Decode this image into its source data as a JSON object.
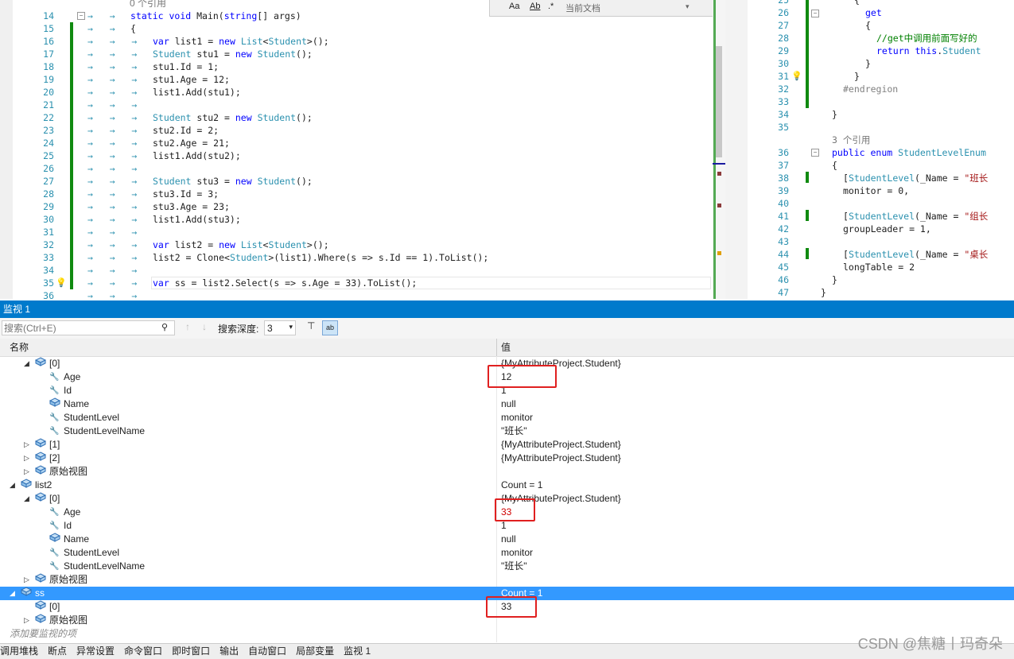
{
  "editor_left": {
    "ref_hint": "0 个引用",
    "lines": [
      {
        "n": "14",
        "code": "static void Main(string[] args)"
      },
      {
        "n": "15",
        "code": "{"
      },
      {
        "n": "16",
        "code": "var list1 = new List<Student>();"
      },
      {
        "n": "17",
        "code": "Student stu1 = new Student();"
      },
      {
        "n": "18",
        "code": "stu1.Id = 1;"
      },
      {
        "n": "19",
        "code": "stu1.Age = 12;"
      },
      {
        "n": "20",
        "code": "list1.Add(stu1);"
      },
      {
        "n": "21",
        "code": ""
      },
      {
        "n": "22",
        "code": "Student stu2 = new Student();"
      },
      {
        "n": "23",
        "code": "stu2.Id = 2;"
      },
      {
        "n": "24",
        "code": "stu2.Age = 21;"
      },
      {
        "n": "25",
        "code": "list1.Add(stu2);"
      },
      {
        "n": "26",
        "code": ""
      },
      {
        "n": "27",
        "code": "Student stu3 = new Student();"
      },
      {
        "n": "28",
        "code": "stu3.Id = 3;"
      },
      {
        "n": "29",
        "code": "stu3.Age = 23;"
      },
      {
        "n": "30",
        "code": "list1.Add(stu3);"
      },
      {
        "n": "31",
        "code": ""
      },
      {
        "n": "32",
        "code": "var list2 = new List<Student>();"
      },
      {
        "n": "33",
        "code": "list2 = Clone<Student>(list1).Where(s => s.Id == 1).ToList();"
      },
      {
        "n": "34",
        "code": ""
      },
      {
        "n": "35",
        "code": "var ss = list2.Select(s => s.Age = 33).ToList();"
      },
      {
        "n": "36",
        "code": ""
      }
    ]
  },
  "find_bar": {
    "label": "当前文档"
  },
  "editor_right": {
    "lines": [
      {
        "n": "25",
        "code": "{"
      },
      {
        "n": "26",
        "code": "get"
      },
      {
        "n": "27",
        "code": "{"
      },
      {
        "n": "28",
        "code": "//get中调用前面写好的"
      },
      {
        "n": "29",
        "code": "return this.Student"
      },
      {
        "n": "30",
        "code": "}"
      },
      {
        "n": "31",
        "code": "}"
      },
      {
        "n": "32",
        "code": "#endregion"
      },
      {
        "n": "33",
        "code": ""
      },
      {
        "n": "34",
        "code": "}"
      },
      {
        "n": "35",
        "code": ""
      },
      {
        "n": "",
        "code": "3 个引用"
      },
      {
        "n": "36",
        "code": "public enum StudentLevelEnum"
      },
      {
        "n": "37",
        "code": "{"
      },
      {
        "n": "38",
        "code": "[StudentLevel(_Name = \"班长"
      },
      {
        "n": "39",
        "code": "monitor = 0,"
      },
      {
        "n": "40",
        "code": ""
      },
      {
        "n": "41",
        "code": "[StudentLevel(_Name = \"组长"
      },
      {
        "n": "42",
        "code": "groupLeader = 1,"
      },
      {
        "n": "43",
        "code": ""
      },
      {
        "n": "44",
        "code": "[StudentLevel(_Name = \"桌长"
      },
      {
        "n": "45",
        "code": "longTable = 2"
      },
      {
        "n": "46",
        "code": "}"
      },
      {
        "n": "47",
        "code": "}"
      }
    ]
  },
  "watch": {
    "title": "监视 1",
    "search_placeholder": "搜索(Ctrl+E)",
    "depth_label": "搜索深度:",
    "depth_value": "3",
    "col_name": "名称",
    "col_value": "值",
    "rows": [
      {
        "name": "[0]",
        "value": "{MyAttributeProject.Student}",
        "level": 2,
        "expand": "open",
        "icon": "obj"
      },
      {
        "name": "Age",
        "value": "12",
        "level": 3,
        "icon": "wrench"
      },
      {
        "name": "Id",
        "value": "1",
        "level": 3,
        "icon": "wrench"
      },
      {
        "name": "Name",
        "value": "null",
        "level": 3,
        "icon": "obj"
      },
      {
        "name": "StudentLevel",
        "value": "monitor",
        "level": 3,
        "icon": "wrench"
      },
      {
        "name": "StudentLevelName",
        "value": "\"班长\"",
        "level": 3,
        "icon": "wrench"
      },
      {
        "name": "[1]",
        "value": "{MyAttributeProject.Student}",
        "level": 2,
        "expand": "closed",
        "icon": "obj"
      },
      {
        "name": "[2]",
        "value": "{MyAttributeProject.Student}",
        "level": 2,
        "expand": "closed",
        "icon": "obj"
      },
      {
        "name": "原始视图",
        "value": "",
        "level": 2,
        "expand": "closed",
        "icon": "obj"
      },
      {
        "name": "list2",
        "value": "Count = 1",
        "level": 1,
        "expand": "open",
        "icon": "obj"
      },
      {
        "name": "[0]",
        "value": "{MyAttributeProject.Student}",
        "level": 2,
        "expand": "open",
        "icon": "obj"
      },
      {
        "name": "Age",
        "value": "33",
        "level": 3,
        "icon": "wrench",
        "red": true
      },
      {
        "name": "Id",
        "value": "1",
        "level": 3,
        "icon": "wrench"
      },
      {
        "name": "Name",
        "value": "null",
        "level": 3,
        "icon": "obj"
      },
      {
        "name": "StudentLevel",
        "value": "monitor",
        "level": 3,
        "icon": "wrench"
      },
      {
        "name": "StudentLevelName",
        "value": "\"班长\"",
        "level": 3,
        "icon": "wrench"
      },
      {
        "name": "原始视图",
        "value": "",
        "level": 2,
        "expand": "closed",
        "icon": "obj"
      },
      {
        "name": "ss",
        "value": "Count = 1",
        "level": 1,
        "expand": "open",
        "icon": "obj",
        "selected": true
      },
      {
        "name": "[0]",
        "value": "33",
        "level": 2,
        "icon": "obj"
      },
      {
        "name": "原始视图",
        "value": "",
        "level": 2,
        "expand": "closed",
        "icon": "obj"
      }
    ],
    "add_hint": "添加要监视的项"
  },
  "bottom_tabs": [
    "调用堆栈",
    "断点",
    "异常设置",
    "命令窗口",
    "即时窗口",
    "输出",
    "自动窗口",
    "局部变量",
    "监视 1"
  ],
  "watermark": "CSDN @焦糖丨玛奇朵"
}
